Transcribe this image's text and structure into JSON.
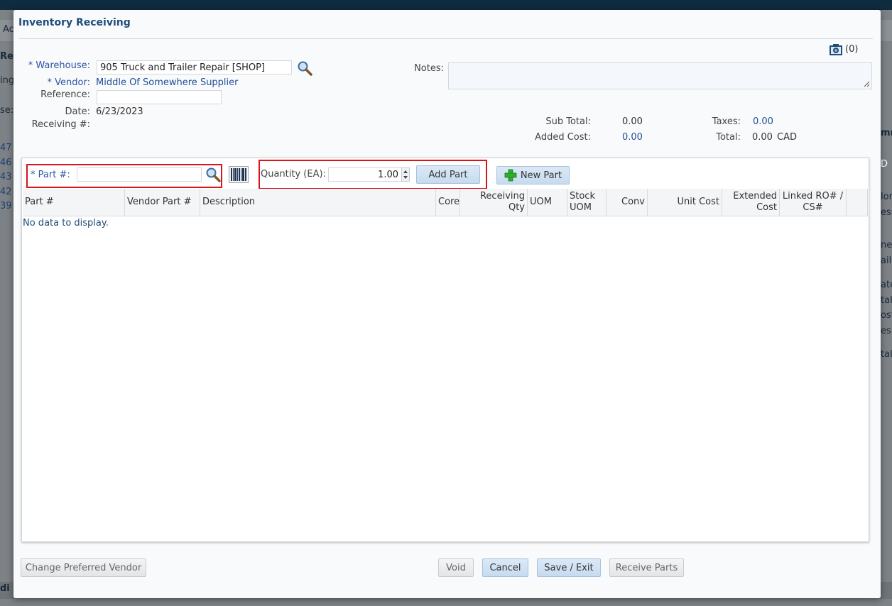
{
  "background": {
    "left_labels": [
      "Ac",
      "Rec",
      "ing",
      "se:"
    ],
    "left_numbers": [
      "47",
      "46",
      "43",
      "42",
      "39"
    ],
    "right_labels": [
      "mn",
      "D",
      "lor:",
      "ess:",
      "ne:",
      "ail:",
      "ate:",
      "tal:",
      "ost:",
      "es:",
      "tal:"
    ],
    "bottom_label": "di"
  },
  "modal": {
    "title": "Inventory Receiving",
    "attachments": {
      "icon": "camera-icon",
      "count": "(0)"
    },
    "form": {
      "warehouse_label": "* Warehouse:",
      "warehouse_value": "905 Truck and Trailer Repair [SHOP]",
      "vendor_label": "* Vendor:",
      "vendor_value": "Middle Of Somewhere Supplier",
      "reference_label": "Reference:",
      "reference_value": "",
      "date_label": "Date:",
      "date_value": "6/23/2023",
      "receiving_label": "Receiving #:",
      "receiving_value": "",
      "notes_label": "Notes:",
      "notes_value": ""
    },
    "totals": {
      "subtotal_label": "Sub Total:",
      "subtotal_value": "0.00",
      "added_cost_label": "Added Cost:",
      "added_cost_value": "0.00",
      "taxes_label": "Taxes:",
      "taxes_value": "0.00",
      "total_label": "Total:",
      "total_value": "0.00",
      "currency": "CAD"
    },
    "toolbar": {
      "part_label": "* Part #:",
      "part_value": "",
      "quantity_label": "Quantity (EA):",
      "quantity_value": "1.00",
      "add_part_label": "Add Part",
      "new_part_label": "New Part"
    },
    "grid": {
      "columns": [
        "Part #",
        "Vendor Part #",
        "Description",
        "Core",
        "Receiving Qty",
        "UOM",
        "Stock UOM",
        "Conv",
        "Unit Cost",
        "Extended Cost",
        "Linked RO# / CS#"
      ],
      "empty_text": "No data to display."
    },
    "footer": {
      "change_vendor_label": "Change Preferred Vendor",
      "void_label": "Void",
      "cancel_label": "Cancel",
      "save_exit_label": "Save / Exit",
      "receive_parts_label": "Receive Parts"
    },
    "colors": {
      "accent_red": "#d9141a",
      "title_blue": "#1f4e79",
      "link_blue": "#1f4e9b"
    }
  }
}
